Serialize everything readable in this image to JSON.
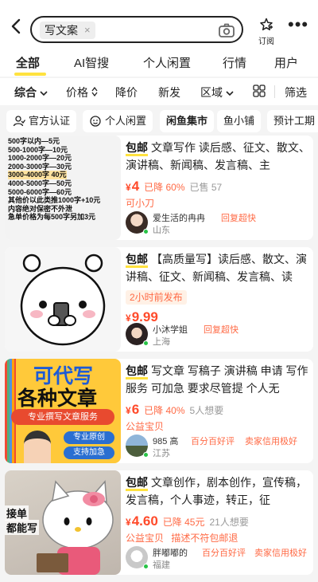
{
  "search": {
    "query": "写文案",
    "clear": "×"
  },
  "header": {
    "subscribe_label": "订阅",
    "more_label": "•••"
  },
  "tabs": [
    "全部",
    "AI智搜",
    "个人闲置",
    "行情",
    "用户"
  ],
  "sort": {
    "items": [
      "综合",
      "价格",
      "降价",
      "新发",
      "区域"
    ],
    "filter_label": "筛选"
  },
  "chips": [
    "官方认证",
    "个人闲置",
    "闲鱼集市",
    "鱼小铺",
    "预计工期"
  ],
  "products": [
    {
      "tag": "包邮",
      "title": "文章写作 读后感、征文、散文、演讲稿、新闻稿、发言稿、主",
      "currency": "¥",
      "price": "4",
      "drop": "已降 60%",
      "sold": "已售 57",
      "subtag": "可小刀",
      "seller": "爱生活的冉冉",
      "seller_badge": "回复超快",
      "location": "山东",
      "thumb_lines": [
        "500字以内—5元",
        "500-1000字—10元",
        "1000-2000字—20元",
        "2000-3000字—30元",
        "3000-4000字 40元",
        "4000-5000字—50元",
        "5000-6000字—60元",
        "其他价以此类推1000字+10元",
        "内容绝对保密不外泄",
        "急单价格为每500字另加3元"
      ]
    },
    {
      "tag": "包邮",
      "title": "【高质量写】读后感、散文、演讲稿、征文、新闻稿、发言稿、读",
      "currency": "¥",
      "price": "9.99",
      "subtag": "2小时前发布",
      "seller": "小沐学姐",
      "seller_badge": "回复超快",
      "location": "上海"
    },
    {
      "tag": "包邮",
      "title": "写文章 写稿子 演讲稿 申请 写作服务 可加急 要求尽管提 个人无",
      "currency": "¥",
      "price": "6",
      "drop": "已降 40%",
      "sold": "5人想要",
      "subtag": "公益宝贝",
      "seller": "985 高",
      "seller_badge": "百分百好评",
      "seller_badge2": "卖家信用极好",
      "location": "江苏",
      "thumb_title": [
        "可代写",
        "各种文章"
      ],
      "thumb_banner": "专业撰写文章服务",
      "thumb_pills": [
        "专业原创",
        "支持加急"
      ]
    },
    {
      "tag": "包邮",
      "title": "文章创作，剧本创作，宣传稿，发言稿，个人事迹，转正，征",
      "currency": "¥",
      "price": "4.60",
      "drop": "已降 45元",
      "sold": "21人想要",
      "subtag": "公益宝贝",
      "subtag2": "描述不符包邮退",
      "seller": "胖嘟嘟的",
      "seller_badge": "百分百好评",
      "seller_badge2": "卖家信用极好",
      "location": "福建",
      "thumb_lines": [
        "接单",
        "都能写"
      ]
    }
  ],
  "colors": {
    "accent": "#ffe23f",
    "price": "#ff4a2a",
    "orange": "#ff6a45"
  }
}
